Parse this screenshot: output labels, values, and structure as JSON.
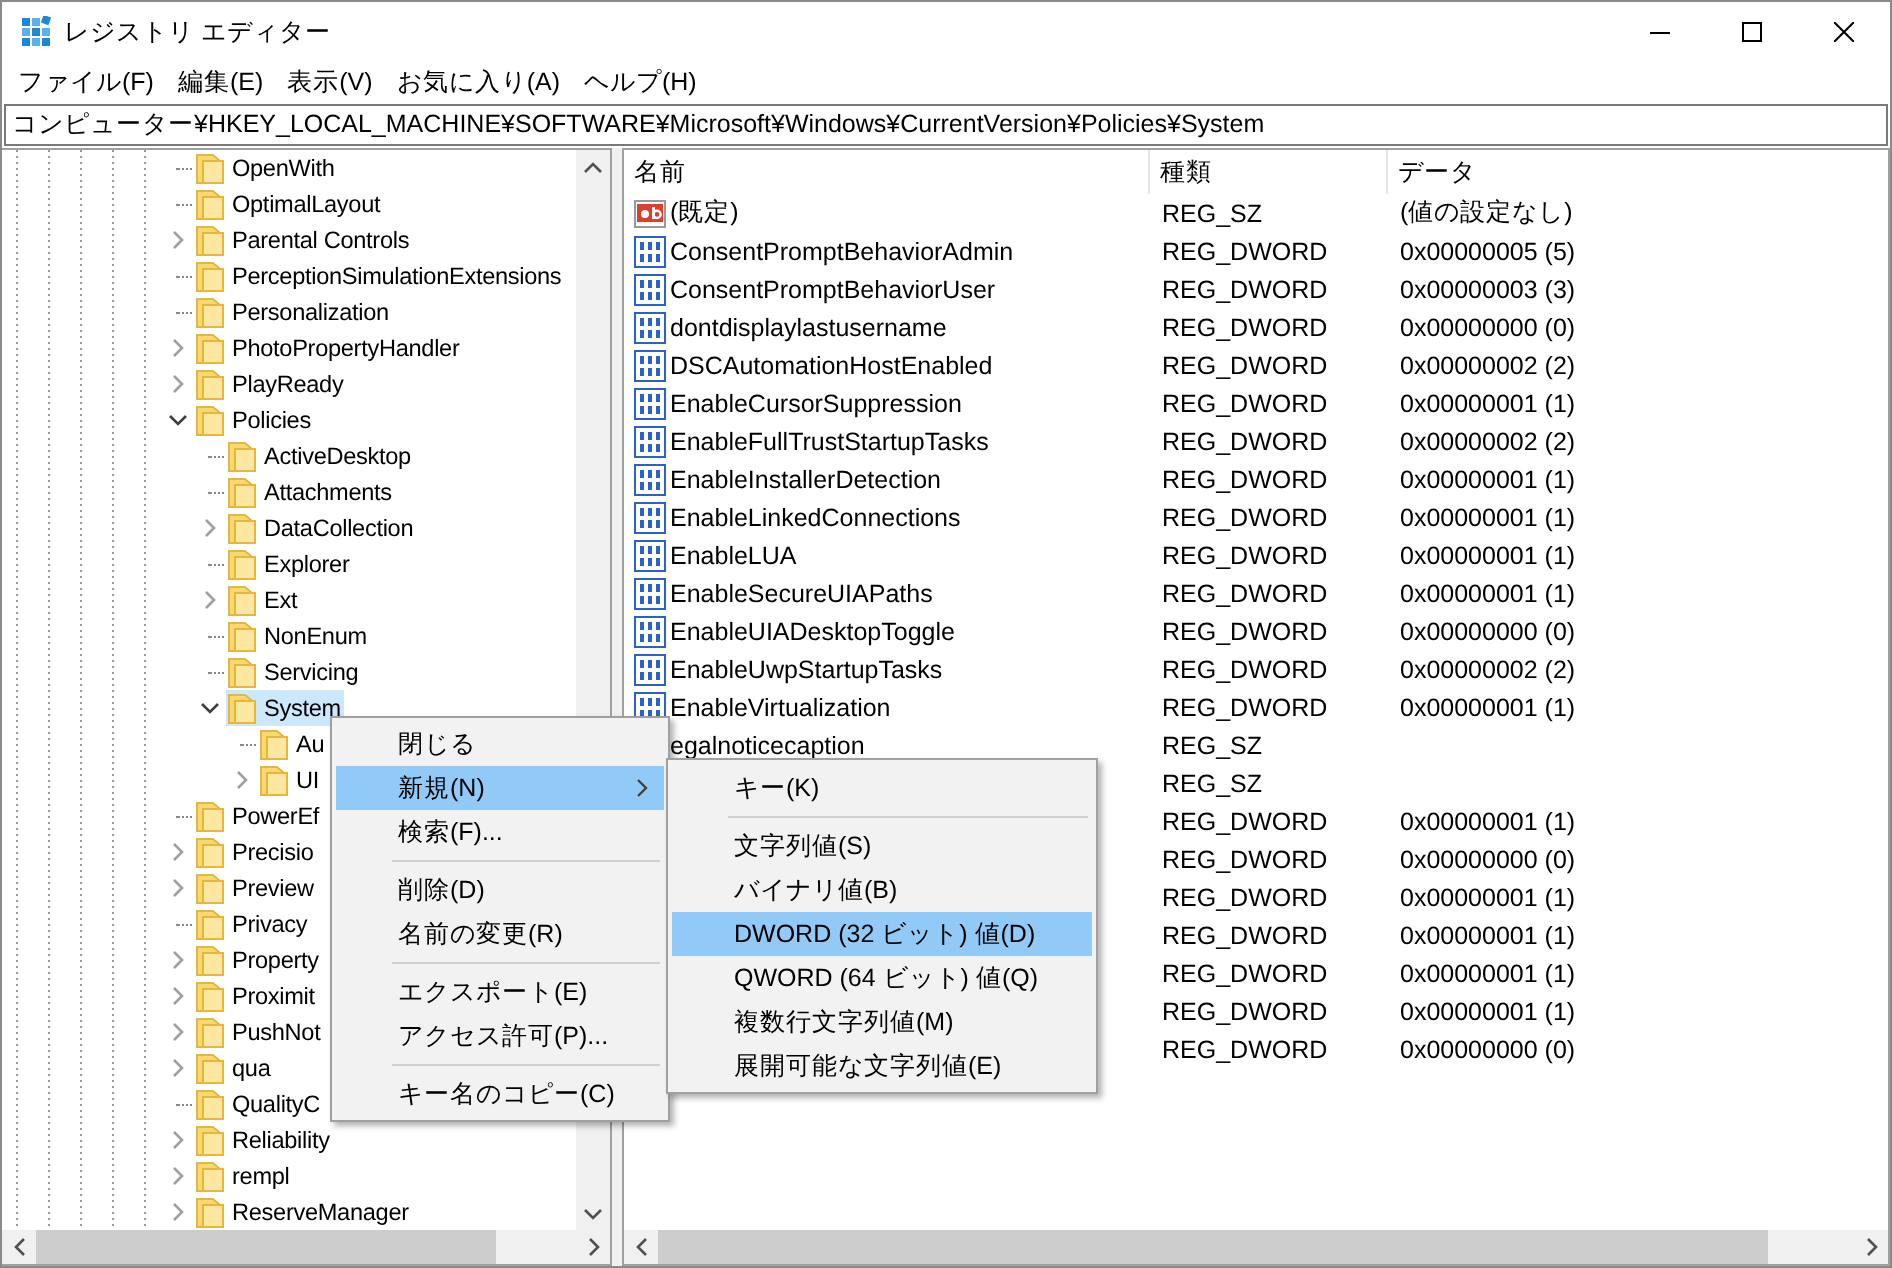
{
  "window": {
    "title": "レジストリ エディター"
  },
  "menu_bar": [
    "ファイル(F)",
    "編集(E)",
    "表示(V)",
    "お気に入り(A)",
    "ヘルプ(H)"
  ],
  "address": "コンピューター¥HKEY_LOCAL_MACHINE¥SOFTWARE¥Microsoft¥Windows¥CurrentVersion¥Policies¥System",
  "tree": [
    {
      "label": "OpenWith",
      "selected": false
    },
    {
      "label": "OptimalLayout",
      "selected": false
    },
    {
      "label": "Parental Controls",
      "selected": false,
      "expanded": false
    },
    {
      "label": "PerceptionSimulationExtensions",
      "selected": false
    },
    {
      "label": "Personalization",
      "selected": false
    },
    {
      "label": "PhotoPropertyHandler",
      "selected": false,
      "expanded": false
    },
    {
      "label": "PlayReady",
      "selected": false,
      "expanded": false
    },
    {
      "label": "Policies",
      "selected": false,
      "expanded": true,
      "children": [
        {
          "label": "ActiveDesktop",
          "selected": false
        },
        {
          "label": "Attachments",
          "selected": false
        },
        {
          "label": "DataCollection",
          "selected": false,
          "expanded": false
        },
        {
          "label": "Explorer",
          "selected": false
        },
        {
          "label": "Ext",
          "selected": false,
          "expanded": false
        },
        {
          "label": "NonEnum",
          "selected": false
        },
        {
          "label": "Servicing",
          "selected": false
        },
        {
          "label": "System",
          "selected": true,
          "expanded": true,
          "children": [
            {
              "label": "Au",
              "selected": false
            },
            {
              "label": "UI",
              "selected": false,
              "expanded": false
            }
          ]
        }
      ]
    },
    {
      "label": "PowerEf",
      "selected": false
    },
    {
      "label": "Precisio",
      "selected": false,
      "expanded": false
    },
    {
      "label": "Preview",
      "selected": false,
      "expanded": false
    },
    {
      "label": "Privacy",
      "selected": false
    },
    {
      "label": "Property",
      "selected": false,
      "expanded": false
    },
    {
      "label": "Proximit",
      "selected": false,
      "expanded": false
    },
    {
      "label": "PushNot",
      "selected": false,
      "expanded": false
    },
    {
      "label": "qua",
      "selected": false,
      "expanded": false
    },
    {
      "label": "QualityC",
      "selected": false
    },
    {
      "label": "Reliability",
      "selected": false,
      "expanded": false
    },
    {
      "label": "rempl",
      "selected": false,
      "expanded": false
    },
    {
      "label": "ReserveManager",
      "selected": false,
      "expanded": false
    }
  ],
  "values": {
    "columns": [
      "名前",
      "種類",
      "データ"
    ],
    "rows": [
      {
        "kind": "string",
        "name": "(既定)",
        "type": "REG_SZ",
        "data": "(値の設定なし)"
      },
      {
        "kind": "dword",
        "name": "ConsentPromptBehaviorAdmin",
        "type": "REG_DWORD",
        "data": "0x00000005 (5)"
      },
      {
        "kind": "dword",
        "name": "ConsentPromptBehaviorUser",
        "type": "REG_DWORD",
        "data": "0x00000003 (3)"
      },
      {
        "kind": "dword",
        "name": "dontdisplaylastusername",
        "type": "REG_DWORD",
        "data": "0x00000000 (0)"
      },
      {
        "kind": "dword",
        "name": "DSCAutomationHostEnabled",
        "type": "REG_DWORD",
        "data": "0x00000002 (2)"
      },
      {
        "kind": "dword",
        "name": "EnableCursorSuppression",
        "type": "REG_DWORD",
        "data": "0x00000001 (1)"
      },
      {
        "kind": "dword",
        "name": "EnableFullTrustStartupTasks",
        "type": "REG_DWORD",
        "data": "0x00000002 (2)"
      },
      {
        "kind": "dword",
        "name": "EnableInstallerDetection",
        "type": "REG_DWORD",
        "data": "0x00000001 (1)"
      },
      {
        "kind": "dword",
        "name": "EnableLinkedConnections",
        "type": "REG_DWORD",
        "data": "0x00000001 (1)"
      },
      {
        "kind": "dword",
        "name": "EnableLUA",
        "type": "REG_DWORD",
        "data": "0x00000001 (1)"
      },
      {
        "kind": "dword",
        "name": "EnableSecureUIAPaths",
        "type": "REG_DWORD",
        "data": "0x00000001 (1)"
      },
      {
        "kind": "dword",
        "name": "EnableUIADesktopToggle",
        "type": "REG_DWORD",
        "data": "0x00000000 (0)"
      },
      {
        "kind": "dword",
        "name": "EnableUwpStartupTasks",
        "type": "REG_DWORD",
        "data": "0x00000002 (2)"
      },
      {
        "kind": "dword",
        "name": "EnableVirtualization",
        "type": "REG_DWORD",
        "data": "0x00000001 (1)"
      },
      {
        "name": "egalnoticecaption",
        "type": "REG_SZ"
      },
      {
        "type": "REG_SZ"
      },
      {
        "type": "REG_DWORD",
        "data": "0x00000001 (1)"
      },
      {
        "type": "REG_DWORD",
        "data": "0x00000000 (0)"
      },
      {
        "type": "REG_DWORD",
        "data": "0x00000001 (1)"
      },
      {
        "type": "REG_DWORD",
        "data": "0x00000001 (1)"
      },
      {
        "type": "REG_DWORD",
        "data": "0x00000001 (1)"
      },
      {
        "type": "REG_DWORD",
        "data": "0x00000001 (1)"
      },
      {
        "type": "REG_DWORD",
        "data": "0x00000000 (0)"
      }
    ]
  },
  "context_menu": {
    "items": [
      {
        "kind": "item",
        "label": "閉じる",
        "selected": false
      },
      {
        "kind": "item",
        "label": "新規(N)",
        "selected": true,
        "submenu": true
      },
      {
        "kind": "item",
        "label": "検索(F)...",
        "selected": false
      },
      {
        "kind": "separator"
      },
      {
        "kind": "item",
        "label": "削除(D)",
        "selected": false
      },
      {
        "kind": "item",
        "label": "名前の変更(R)",
        "selected": false
      },
      {
        "kind": "separator"
      },
      {
        "kind": "item",
        "label": "エクスポート(E)",
        "selected": false
      },
      {
        "kind": "item",
        "label": "アクセス許可(P)...",
        "selected": false
      },
      {
        "kind": "separator"
      },
      {
        "kind": "item",
        "label": "キー名のコピー(C)",
        "selected": false
      }
    ]
  },
  "submenu": {
    "items": [
      {
        "kind": "item",
        "label": "キー(K)",
        "selected": false
      },
      {
        "kind": "separator"
      },
      {
        "kind": "item",
        "label": "文字列値(S)",
        "selected": false
      },
      {
        "kind": "item",
        "label": "バイナリ値(B)",
        "selected": false
      },
      {
        "kind": "item",
        "label": "DWORD (32 ビット) 値(D)",
        "selected": true
      },
      {
        "kind": "item",
        "label": "QWORD (64 ビット) 値(Q)",
        "selected": false
      },
      {
        "kind": "item",
        "label": "複数行文字列値(M)",
        "selected": false
      },
      {
        "kind": "item",
        "label": "展開可能な文字列値(E)",
        "selected": false
      }
    ]
  }
}
